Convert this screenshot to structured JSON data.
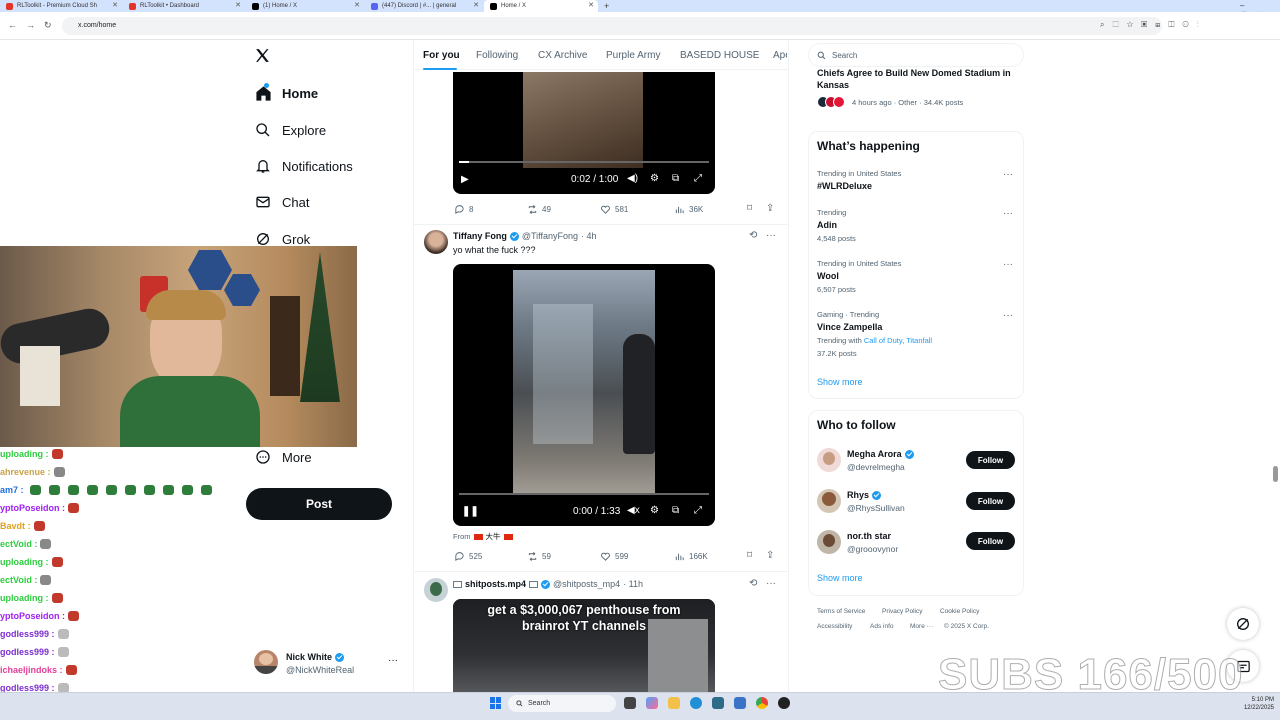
{
  "browser": {
    "tabs": [
      {
        "label": "RLToolkit - Premium Cloud Sh",
        "color": "#e5352b"
      },
      {
        "label": "RLToolkit • Dashboard",
        "color": "#e5352b"
      },
      {
        "label": "(1) Home / X",
        "color": "#000000"
      },
      {
        "label": "(447) Discord | #... | general",
        "color": "#5865f2"
      },
      {
        "label": "Home / X",
        "color": "#000000"
      }
    ],
    "url": "x.com/home"
  },
  "nav": {
    "home": "Home",
    "explore": "Explore",
    "notifications": "Notifications",
    "chat": "Chat",
    "grok": "Grok",
    "more": "More",
    "post": "Post",
    "account_name": "Nick White",
    "account_handle": "@NickWhiteReal"
  },
  "stream_chat": [
    {
      "user": "uploading :",
      "color": "#2ecc40"
    },
    {
      "user": "ahrevenue :",
      "color": "#c9a24a"
    },
    {
      "user": "am7 :",
      "color": "#1d6fe0"
    },
    {
      "user": "yptoPoseidon :",
      "color": "#a020f0"
    },
    {
      "user": "Bavdt :",
      "color": "#e0a020"
    },
    {
      "user": "ectVoid :",
      "color": "#2ecc40"
    },
    {
      "user": "uploading :",
      "color": "#2ecc40"
    },
    {
      "user": "ectVoid :",
      "color": "#2ecc40"
    },
    {
      "user": "uploading :",
      "color": "#2ecc40"
    },
    {
      "user": "yptoPoseidon :",
      "color": "#a020f0"
    },
    {
      "user": "godless999 :",
      "color": "#7d2fd0"
    },
    {
      "user": "godless999 :",
      "color": "#7d2fd0"
    },
    {
      "user": "ichaeljindoks :",
      "color": "#e0409a"
    },
    {
      "user": "godless999 :",
      "color": "#7d2fd0"
    }
  ],
  "feed": {
    "tabs": [
      "For you",
      "Following",
      "CX Archive",
      "Purple Army",
      "BASEDD HOUSE",
      "Ape"
    ],
    "tweet1": {
      "video_time": "0:02 / 1:00",
      "replies": "8",
      "reposts": "49",
      "likes": "581",
      "views": "36K"
    },
    "tweet2": {
      "name": "Tiffany Fong",
      "handle": "@TiffanyFong",
      "time": "· 4h",
      "text": "yo what the fuck ???",
      "video_time": "0:00 / 1:33",
      "from_label": "From",
      "from_source": "大牛",
      "replies": "525",
      "reposts": "59",
      "likes": "599",
      "views": "166K"
    },
    "tweet3": {
      "name": "shitposts.mp4",
      "handle": "@shitposts_mp4",
      "time": "· 11h",
      "video_caption": "get a $3,000,067 penthouse from brainrot YT channels"
    }
  },
  "sidebar": {
    "search_placeholder": "Search",
    "news": {
      "title": "Chiefs Agree to Build New Domed Stadium in Kansas",
      "meta": "4 hours ago · Other · 34.4K posts"
    },
    "whats_happening": "What’s happening",
    "trends": [
      {
        "context": "Trending in United States",
        "name": "#WLRDeluxe",
        "posts": ""
      },
      {
        "context": "Trending",
        "name": "Adin",
        "posts": "4,548 posts"
      },
      {
        "context": "Trending in United States",
        "name": "Wool",
        "posts": "6,507 posts"
      },
      {
        "context": "Gaming · Trending",
        "name": "Vince Zampella",
        "with_label": "Trending with",
        "with_1": "Call of Duty",
        "with_2": "Titanfall",
        "posts": "37.2K posts"
      }
    ],
    "show_more": "Show more",
    "who_to_follow": "Who to follow",
    "follow_label": "Follow",
    "suggestions": [
      {
        "name": "Megha Arora",
        "handle": "@devrelmegha"
      },
      {
        "name": "Rhys",
        "handle": "@RhysSullivan"
      },
      {
        "name": "nor.th star",
        "handle": "@grooovynor"
      }
    ],
    "footer": [
      "Terms of Service",
      "Privacy Policy",
      "Cookie Policy",
      "Accessibility",
      "Ads info",
      "More ···",
      "© 2025 X Corp."
    ]
  },
  "overlay": {
    "subs": "SUBS 166/500"
  },
  "taskbar": {
    "search": "Search",
    "time": "5:10 PM",
    "date": "12/22/2025"
  }
}
